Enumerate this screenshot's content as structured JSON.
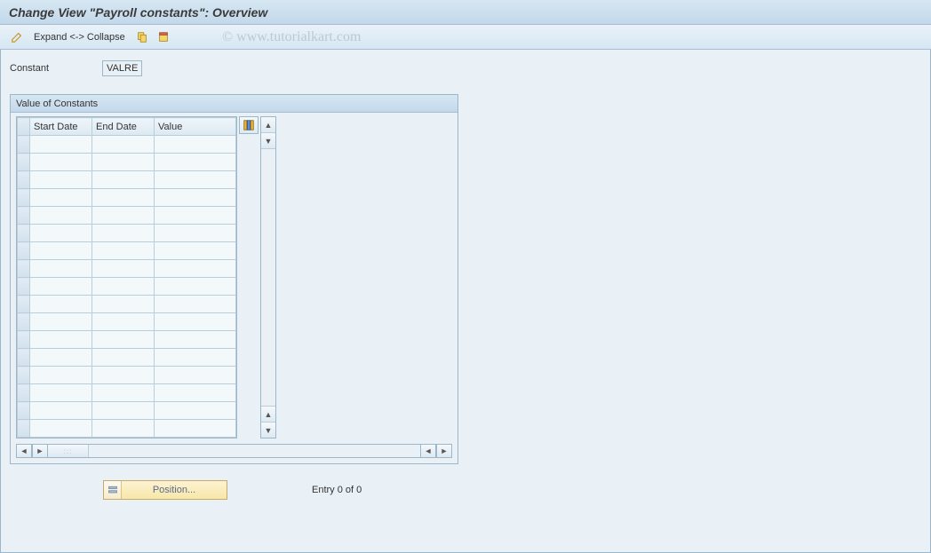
{
  "title": "Change View \"Payroll constants\": Overview",
  "toolbar": {
    "expand_label": "Expand <-> Collapse"
  },
  "watermark": "©   www.tutorialkart.com",
  "form": {
    "constant_label": "Constant",
    "constant_value": "VALRE"
  },
  "groupbox": {
    "title": "Value of Constants",
    "columns": {
      "start_date": "Start Date",
      "end_date": "End Date",
      "value": "Value"
    },
    "rows": [
      {
        "start": "",
        "end": "",
        "value": ""
      },
      {
        "start": "",
        "end": "",
        "value": ""
      },
      {
        "start": "",
        "end": "",
        "value": ""
      },
      {
        "start": "",
        "end": "",
        "value": ""
      },
      {
        "start": "",
        "end": "",
        "value": ""
      },
      {
        "start": "",
        "end": "",
        "value": ""
      },
      {
        "start": "",
        "end": "",
        "value": ""
      },
      {
        "start": "",
        "end": "",
        "value": ""
      },
      {
        "start": "",
        "end": "",
        "value": ""
      },
      {
        "start": "",
        "end": "",
        "value": ""
      },
      {
        "start": "",
        "end": "",
        "value": ""
      },
      {
        "start": "",
        "end": "",
        "value": ""
      },
      {
        "start": "",
        "end": "",
        "value": ""
      },
      {
        "start": "",
        "end": "",
        "value": ""
      },
      {
        "start": "",
        "end": "",
        "value": ""
      },
      {
        "start": "",
        "end": "",
        "value": ""
      },
      {
        "start": "",
        "end": "",
        "value": ""
      }
    ]
  },
  "footer": {
    "position_label": "Position...",
    "entry_status": "Entry 0 of 0"
  }
}
